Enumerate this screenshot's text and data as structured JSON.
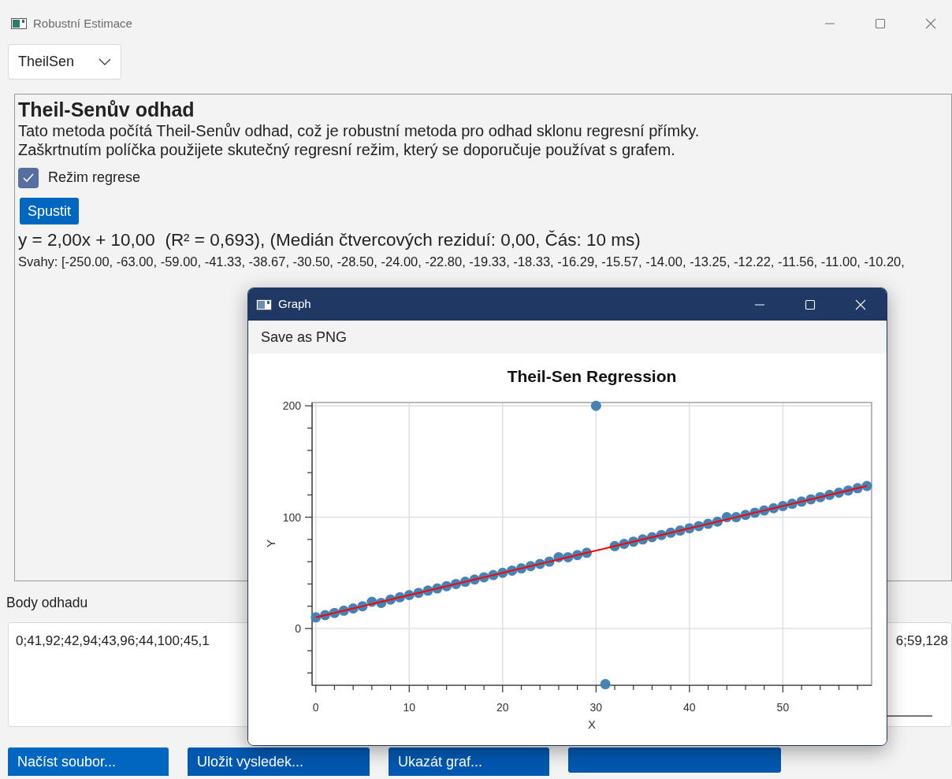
{
  "window": {
    "title": "Robustní Estimace"
  },
  "method_dropdown": {
    "value": "TheilSen"
  },
  "panel": {
    "heading": "Theil-Senův odhad",
    "description": [
      "Tato metoda počítá Theil-Senův odhad, což je robustní metoda pro odhad sklonu regresní přímky.",
      "Zaškrtnutím políčka použijete skutečný regresní režim, který se doporučuje používat s grafem."
    ],
    "regression_mode": {
      "label": "Režim regrese",
      "checked": true
    },
    "run_button": "Spustit",
    "result": "y = 2,00x + 10,00  (R² = 0,693), (Medián čtvercových reziduí: 0,00, Čás: 10 ms)",
    "slopes": "Svahy: [-250.00, -63.00, -59.00, -41.33, -38.67, -30.50, -28.50, -24.00, -22.80, -19.33, -18.33, -16.29, -15.57, -14.00, -13.25, -12.22, -11.56, -11.00, -10.20,"
  },
  "points_section": {
    "label": "Body odhadu",
    "value_left": "0;41,92;42,94;43,96;44,100;45,1",
    "value_right": "6;59,128"
  },
  "buttons": [
    "Načíst soubor...",
    "Uložit vysledek...",
    "Ukazát graf..."
  ],
  "graph_window": {
    "title": "Graph",
    "menu": [
      "Save as PNG"
    ],
    "chart_data": {
      "type": "scatter",
      "title": "Theil-Sen Regression",
      "xlabel": "X",
      "ylabel": "Y",
      "x": [
        0,
        1,
        2,
        3,
        4,
        5,
        6,
        7,
        8,
        9,
        10,
        11,
        12,
        13,
        14,
        15,
        16,
        17,
        18,
        19,
        20,
        21,
        22,
        23,
        24,
        25,
        26,
        27,
        28,
        29,
        30,
        31,
        32,
        33,
        34,
        35,
        36,
        37,
        38,
        39,
        40,
        41,
        42,
        43,
        44,
        45,
        46,
        47,
        48,
        49,
        50,
        51,
        52,
        53,
        54,
        55,
        56,
        57,
        58,
        59
      ],
      "series": [
        {
          "type": "scatter",
          "color": "#4682b4",
          "values": [
            10,
            12,
            14,
            16,
            18,
            20,
            24,
            23,
            26,
            28,
            30,
            32,
            34,
            36,
            38,
            40,
            42,
            44,
            46,
            48,
            50,
            52,
            54,
            56,
            58,
            60,
            64,
            64,
            66,
            68,
            200,
            -50,
            74,
            76,
            78,
            80,
            82,
            84,
            86,
            88,
            90,
            92,
            94,
            96,
            100,
            100,
            102,
            104,
            106,
            108,
            110,
            112,
            114,
            116,
            118,
            120,
            122,
            124,
            126,
            128
          ]
        },
        {
          "type": "line",
          "color": "#ff0000",
          "values": [
            10,
            12,
            14,
            16,
            18,
            20,
            22,
            24,
            26,
            28,
            30,
            32,
            34,
            36,
            38,
            40,
            42,
            44,
            46,
            48,
            50,
            52,
            54,
            56,
            58,
            60,
            62,
            64,
            66,
            68,
            70,
            72,
            74,
            76,
            78,
            80,
            82,
            84,
            86,
            88,
            90,
            92,
            94,
            96,
            98,
            100,
            102,
            104,
            106,
            108,
            110,
            112,
            114,
            116,
            118,
            120,
            122,
            124,
            126,
            128
          ]
        }
      ],
      "xlim": [
        -0.4,
        59.5
      ],
      "ylim": [
        -51,
        203
      ],
      "xticks": [
        0,
        10,
        20,
        30,
        40,
        50
      ],
      "yticks": [
        0,
        100,
        200
      ],
      "grid": true
    }
  }
}
